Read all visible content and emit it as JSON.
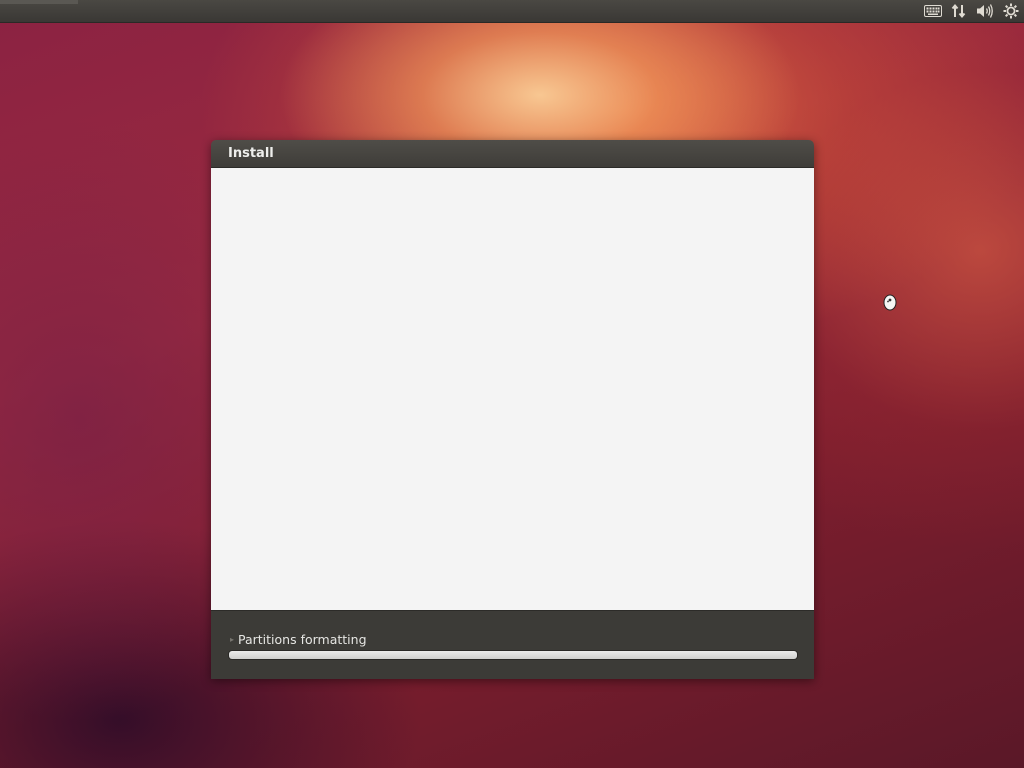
{
  "top_panel": {
    "indicators": [
      {
        "icon": "keyboard-icon"
      },
      {
        "icon": "network-icon"
      },
      {
        "icon": "volume-icon"
      },
      {
        "icon": "gear-icon"
      }
    ]
  },
  "window": {
    "title": "Install",
    "status_text": "Partitions formatting",
    "progress_fraction": 1.0
  },
  "colors": {
    "panel": "#3c3b37",
    "content_bg": "#f4f4f4",
    "progress": "#e4e4e2"
  }
}
